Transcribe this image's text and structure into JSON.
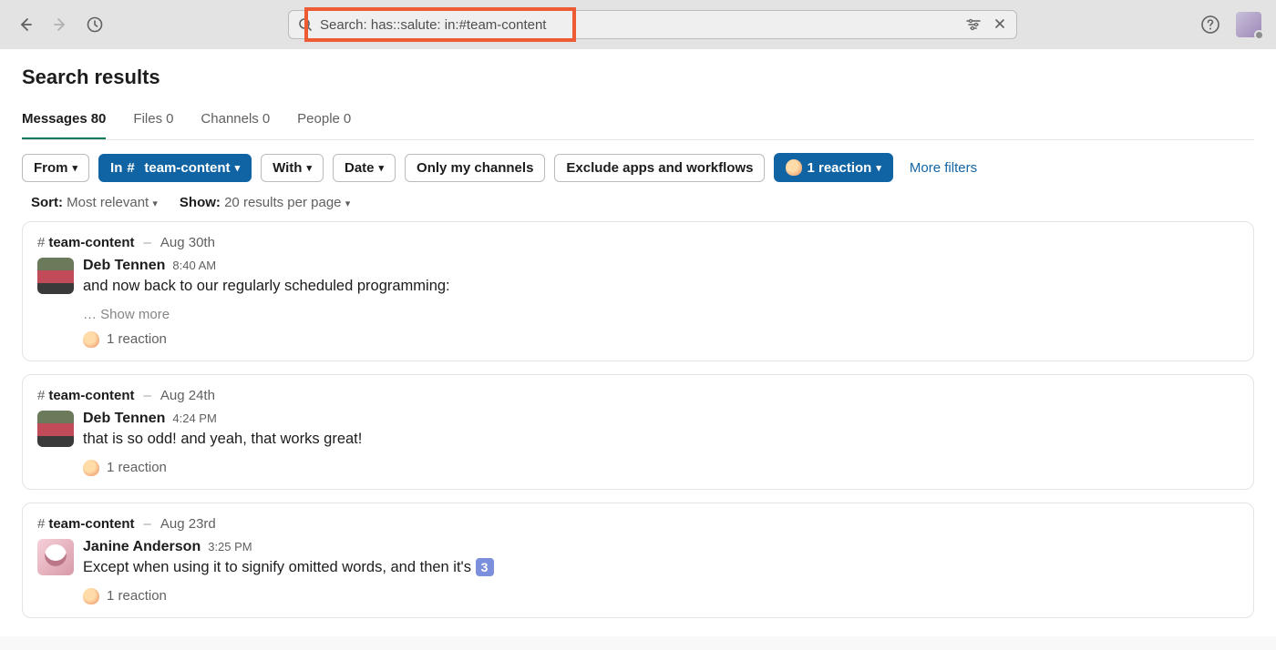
{
  "search": {
    "text": "Search: has::salute: in:#team-content"
  },
  "header": {
    "title": "Search results"
  },
  "tabs": [
    {
      "label": "Messages",
      "count": "80",
      "active": true
    },
    {
      "label": "Files",
      "count": "0",
      "active": false
    },
    {
      "label": "Channels",
      "count": "0",
      "active": false
    },
    {
      "label": "People",
      "count": "0",
      "active": false
    }
  ],
  "filters": {
    "from": "From",
    "in_prefix": "In",
    "in_channel": "team-content",
    "with": "With",
    "date": "Date",
    "only_my": "Only my channels",
    "exclude": "Exclude apps and workflows",
    "reaction": "1 reaction",
    "more": "More filters"
  },
  "sort": {
    "sort_label": "Sort:",
    "sort_value": "Most relevant",
    "show_label": "Show:",
    "show_value": "20 results per page"
  },
  "results": [
    {
      "channel": "team-content",
      "date": "Aug 30th",
      "author": "Deb Tennen",
      "time": "8:40 AM",
      "text": "and now back to our regularly scheduled programming:",
      "show_more": "… Show more",
      "reaction_text": "1 reaction",
      "avatar": "av1"
    },
    {
      "channel": "team-content",
      "date": "Aug 24th",
      "author": "Deb Tennen",
      "time": "4:24 PM",
      "text": "that is so odd! and yeah, that works great!",
      "reaction_text": "1 reaction",
      "avatar": "av1"
    },
    {
      "channel": "team-content",
      "date": "Aug 23rd",
      "author": "Janine Anderson",
      "time": "3:25 PM",
      "text": "Except when using it to signify omitted words, and then it's ",
      "trailing_emoji": "3",
      "reaction_text": "1 reaction",
      "avatar": "av2"
    }
  ]
}
